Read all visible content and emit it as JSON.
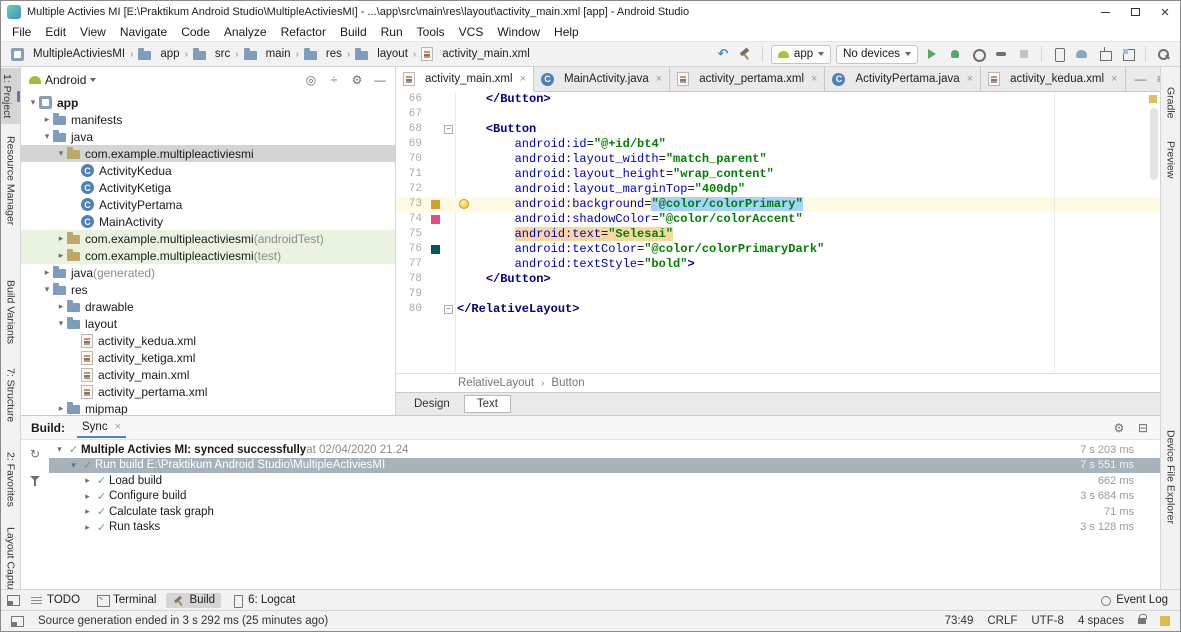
{
  "window": {
    "title": "Multiple Activies MI [E:\\Praktikum Android Studio\\MultipleActiviesMI] - ...\\app\\src\\main\\res\\layout\\activity_main.xml [app] - Android Studio"
  },
  "menu": {
    "items": [
      "File",
      "Edit",
      "View",
      "Navigate",
      "Code",
      "Analyze",
      "Refactor",
      "Build",
      "Run",
      "Tools",
      "VCS",
      "Window",
      "Help"
    ]
  },
  "toolbar": {
    "breadcrumbs": [
      {
        "label": "MultipleActiviesMI",
        "icon": "project"
      },
      {
        "label": "app",
        "icon": "folder"
      },
      {
        "label": "src",
        "icon": "folder"
      },
      {
        "label": "main",
        "icon": "folder"
      },
      {
        "label": "res",
        "icon": "folder"
      },
      {
        "label": "layout",
        "icon": "folder"
      },
      {
        "label": "activity_main.xml",
        "icon": "xml"
      }
    ],
    "icons_pre": [
      "back-arrow-icon",
      "build-hammer-icon"
    ],
    "run_config": "app",
    "device_select": "No devices",
    "icons_run": [
      "run-icon",
      "debug-icon",
      "profiler-icon",
      "attach-debugger-icon",
      "stop-icon"
    ],
    "icons_tools": [
      "avd-manager-icon",
      "sync-gradle-icon",
      "sdk-manager-icon",
      "layout-inspector-icon"
    ],
    "icons_end": [
      "search-everywhere-icon"
    ]
  },
  "left_stripe": {
    "items": [
      {
        "label": "1: Project",
        "selected": true,
        "icon": "project-tool-icon"
      },
      {
        "label": "Resource Manager"
      },
      {
        "label": "Build Variants"
      },
      {
        "label": "7: Structure"
      },
      {
        "label": "2: Favorites"
      },
      {
        "label": "Layout Captures"
      }
    ]
  },
  "right_stripe": {
    "items": [
      {
        "label": "Gradle"
      },
      {
        "label": "Preview"
      },
      {
        "label": "Device File Explorer"
      }
    ]
  },
  "project_panel": {
    "view_select": "Android",
    "header_icons": [
      "locate-icon",
      "collapse-all-icon",
      "settings-gear-icon",
      "hide-panel-icon"
    ],
    "tree": [
      {
        "label": "app",
        "type": "app",
        "chev": "down",
        "bold": true,
        "indent": 0
      },
      {
        "label": "manifests",
        "type": "folder",
        "chev": "right",
        "indent": 1
      },
      {
        "label": "java",
        "type": "folder",
        "chev": "down",
        "indent": 1
      },
      {
        "label": "com.example.multipleactiviesmi",
        "type": "package",
        "chev": "down",
        "indent": 2,
        "selected": true
      },
      {
        "label": "ActivityKedua",
        "type": "class",
        "indent": 3
      },
      {
        "label": "ActivityKetiga",
        "type": "class",
        "indent": 3
      },
      {
        "label": "ActivityPertama",
        "type": "class",
        "indent": 3
      },
      {
        "label": "MainActivity",
        "type": "class",
        "indent": 3
      },
      {
        "label": "com.example.multipleactiviesmi",
        "suffix": " (androidTest)",
        "type": "package",
        "chev": "right",
        "indent": 2,
        "bg": "test"
      },
      {
        "label": "com.example.multipleactiviesmi",
        "suffix": " (test)",
        "type": "package",
        "chev": "right",
        "indent": 2,
        "bg": "test"
      },
      {
        "label": "java",
        "suffix": " (generated)",
        "type": "folder",
        "chev": "right",
        "indent": 1
      },
      {
        "label": "res",
        "type": "folder",
        "chev": "down",
        "indent": 1
      },
      {
        "label": "drawable",
        "type": "folder",
        "chev": "right",
        "indent": 2
      },
      {
        "label": "layout",
        "type": "folder",
        "chev": "down",
        "indent": 2
      },
      {
        "label": "activity_kedua.xml",
        "type": "xml",
        "indent": 3
      },
      {
        "label": "activity_ketiga.xml",
        "type": "xml",
        "indent": 3
      },
      {
        "label": "activity_main.xml",
        "type": "xml",
        "indent": 3
      },
      {
        "label": "activity_pertama.xml",
        "type": "xml",
        "indent": 3
      },
      {
        "label": "mipmap",
        "type": "folder",
        "chev": "right",
        "indent": 2
      }
    ]
  },
  "editor": {
    "tabs": [
      {
        "label": "activity_main.xml",
        "icon": "xml",
        "selected": true
      },
      {
        "label": "MainActivity.java",
        "icon": "class"
      },
      {
        "label": "activity_pertama.xml",
        "icon": "xml"
      },
      {
        "label": "ActivityPertama.java",
        "icon": "class"
      },
      {
        "label": "activity_kedua.xml",
        "icon": "xml"
      }
    ],
    "tabbar_icons": [
      "hide-tabs-icon",
      "tab-list-icon"
    ],
    "lines": [
      {
        "n": 66,
        "parts": [
          [
            "p",
            "    "
          ],
          [
            "t",
            "</Button>"
          ]
        ]
      },
      {
        "n": 67,
        "parts": []
      },
      {
        "n": 68,
        "fold": true,
        "parts": [
          [
            "p",
            "    "
          ],
          [
            "t",
            "<Button"
          ]
        ]
      },
      {
        "n": 69,
        "parts": [
          [
            "p",
            "        "
          ],
          [
            "a",
            "android:id"
          ],
          [
            "p",
            "="
          ],
          [
            "v",
            "\"@+id/bt4\""
          ]
        ]
      },
      {
        "n": 70,
        "parts": [
          [
            "p",
            "        "
          ],
          [
            "a",
            "android:layout_width"
          ],
          [
            "p",
            "="
          ],
          [
            "v",
            "\"match_parent\""
          ]
        ]
      },
      {
        "n": 71,
        "parts": [
          [
            "p",
            "        "
          ],
          [
            "a",
            "android:layout_height"
          ],
          [
            "p",
            "="
          ],
          [
            "v",
            "\"wrap_content\""
          ]
        ]
      },
      {
        "n": 72,
        "parts": [
          [
            "p",
            "        "
          ],
          [
            "a",
            "android:layout_marginTop"
          ],
          [
            "p",
            "="
          ],
          [
            "v",
            "\"400dp\""
          ]
        ]
      },
      {
        "n": 73,
        "caret": true,
        "swatch": "#d1a32a",
        "bulb": true,
        "parts": [
          [
            "p",
            "        "
          ],
          [
            "a",
            "android:background"
          ],
          [
            "p",
            "="
          ],
          [
            "vs",
            "\"@color/colorPrimary\""
          ]
        ]
      },
      {
        "n": 74,
        "swatch": "#e54b8c",
        "parts": [
          [
            "p",
            "        "
          ],
          [
            "a",
            "android:shadowColor"
          ],
          [
            "p",
            "="
          ],
          [
            "v",
            "\"@color/colorAccent\""
          ]
        ]
      },
      {
        "n": 75,
        "parts": [
          [
            "p",
            "        "
          ],
          [
            "ahl",
            "android:text"
          ],
          [
            "phl",
            "="
          ],
          [
            "vhl",
            "\"Selesai\""
          ]
        ]
      },
      {
        "n": 76,
        "swatch": "#00585f",
        "parts": [
          [
            "p",
            "        "
          ],
          [
            "a",
            "android:textColor"
          ],
          [
            "p",
            "="
          ],
          [
            "v",
            "\"@color/colorPrimaryDark\""
          ]
        ]
      },
      {
        "n": 77,
        "parts": [
          [
            "p",
            "        "
          ],
          [
            "a",
            "android:textStyle"
          ],
          [
            "p",
            "="
          ],
          [
            "v",
            "\"bold\""
          ],
          [
            "t",
            ">"
          ]
        ]
      },
      {
        "n": 78,
        "parts": [
          [
            "p",
            "    "
          ],
          [
            "t",
            "</Button>"
          ]
        ]
      },
      {
        "n": 79,
        "parts": []
      },
      {
        "n": 80,
        "fold": true,
        "parts": [
          [
            "t",
            "</RelativeLayout>"
          ]
        ]
      }
    ],
    "breadcrumb": [
      "RelativeLayout",
      "Button"
    ],
    "mode_tabs": [
      {
        "label": "Design"
      },
      {
        "label": "Text",
        "selected": true
      }
    ]
  },
  "build_panel": {
    "title": "Build:",
    "tab": "Sync",
    "header_icons": [
      "build-settings-gear-icon",
      "build-collapse-icon"
    ],
    "left_icons": [
      "restart-build-icon",
      "build-filter-icon"
    ],
    "rows": [
      {
        "indent": 0,
        "chev": "down",
        "label": "Multiple Activies MI: synced successfully",
        "bold": true,
        "suffix": " at 02/04/2020 21.24",
        "duration": "7 s 203 ms"
      },
      {
        "indent": 1,
        "chev": "down",
        "label": "Run build E:\\Praktikum Android Studio\\MultipleActiviesMI",
        "selected": true,
        "duration": "7 s 551 ms"
      },
      {
        "indent": 2,
        "chev": "right",
        "label": "Load build",
        "duration": "662 ms"
      },
      {
        "indent": 2,
        "chev": "right",
        "label": "Configure build",
        "duration": "3 s 684 ms"
      },
      {
        "indent": 2,
        "chev": "right",
        "label": "Calculate task graph",
        "duration": "71 ms"
      },
      {
        "indent": 2,
        "chev": "right",
        "label": "Run tasks",
        "duration": "3 s 128 ms"
      }
    ]
  },
  "bottom_bar": {
    "left": [
      {
        "label": "TODO",
        "icon": "todo-icon"
      },
      {
        "label": "Terminal",
        "icon": "terminal-icon"
      },
      {
        "label": "Build",
        "icon": "build-icon",
        "selected": true
      },
      {
        "label": "6: Logcat",
        "icon": "logcat-icon"
      }
    ],
    "right": [
      {
        "label": "Event Log",
        "icon": "event-log-icon"
      }
    ]
  },
  "status_bar": {
    "message": "Source generation ended in 3 s 292 ms (25 minutes ago)",
    "caret": "73:49",
    "line_ending": "CRLF",
    "encoding": "UTF-8",
    "indent": "4 spaces"
  },
  "colors": {
    "selection": "#a6d2ff",
    "caret_line": "#fffae3",
    "usage_highlight": "#fad7a0",
    "test_source_row": "#e9f3df",
    "selected_tree_row": "#d4d4d4",
    "selected_build_row": "#a8b2bd",
    "swatch_color_primary": "#d1a32a",
    "swatch_color_accent": "#e54b8c",
    "swatch_color_primary_dark": "#00585f"
  },
  "icon_glyphs": {
    "back-arrow-icon": "↶",
    "locate-icon": "◎",
    "collapse-all-icon": "÷",
    "settings-gear-icon": "⚙",
    "hide-panel-icon": "—",
    "hide-tabs-icon": "—",
    "tab-list-icon": "≡",
    "build-settings-gear-icon": "⚙",
    "build-collapse-icon": "⊟",
    "restart-build-icon": "↻"
  }
}
